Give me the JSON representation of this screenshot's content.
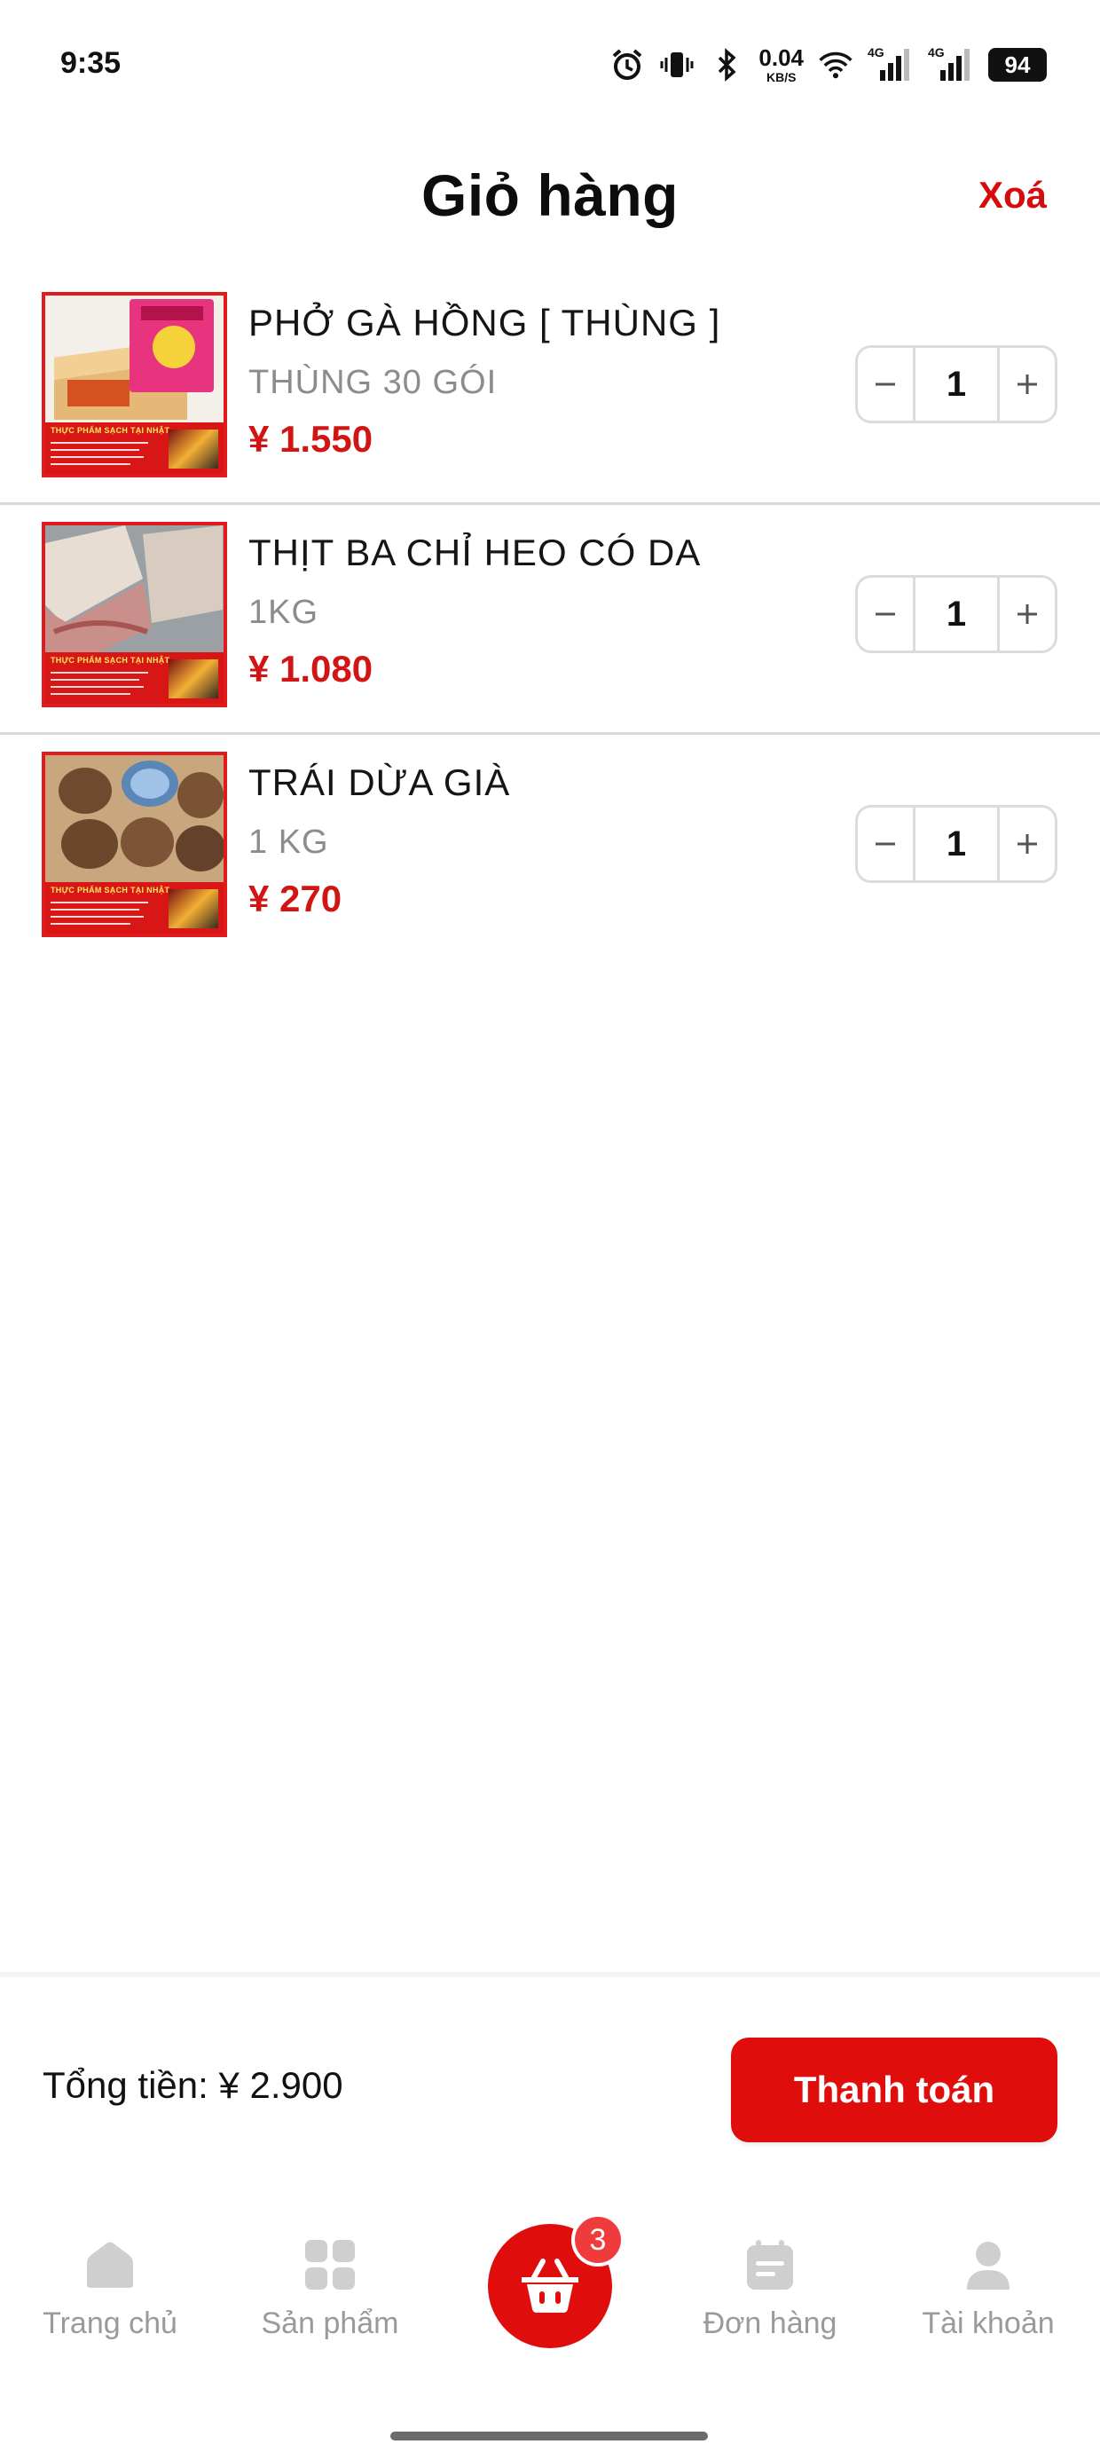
{
  "status_bar": {
    "time": "9:35",
    "net_speed_value": "0.04",
    "net_speed_unit": "KB/S",
    "signal1_label": "4G",
    "signal2_label": "4G",
    "battery": "94",
    "icons": [
      "alarm-icon",
      "vibrate-icon",
      "bluetooth-icon",
      "wifi-icon",
      "signal-icon",
      "signal-icon",
      "battery-icon"
    ]
  },
  "header": {
    "title": "Giỏ hàng",
    "clear_label": "Xoá"
  },
  "cart": {
    "items": [
      {
        "name": "PHỞ GÀ HỒNG [ THÙNG ]",
        "unit": "THÙNG 30 GÓI",
        "price": "¥ 1.550",
        "quantity": "1"
      },
      {
        "name": "THỊT BA CHỈ HEO CÓ DA",
        "unit": "1KG",
        "price": "¥ 1.080",
        "quantity": "1"
      },
      {
        "name": "TRÁI DỪA GIÀ",
        "unit": "1 KG",
        "price": "¥ 270",
        "quantity": "1"
      }
    ],
    "thumb_banner_text": "THỰC PHẨM SẠCH TẠI NHẬT"
  },
  "checkout": {
    "total_label": "Tổng tiền: ¥ 2.900",
    "pay_label": "Thanh toán"
  },
  "nav": {
    "home_label": "Trang chủ",
    "products_label": "Sản phẩm",
    "cart_count": "3",
    "orders_label": "Đơn hàng",
    "account_label": "Tài khoản"
  },
  "colors": {
    "accent": "#e00d0d",
    "price": "#d11414",
    "muted": "#8c8c8c",
    "nav_inactive": "#c9c9c9"
  }
}
